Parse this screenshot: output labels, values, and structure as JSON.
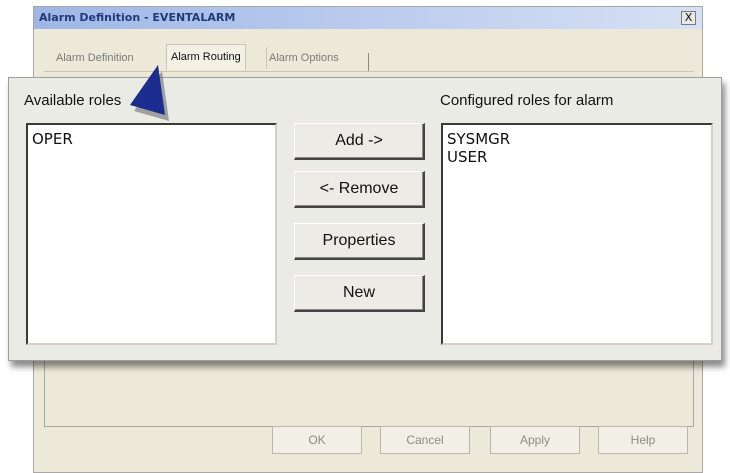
{
  "window": {
    "title": "Alarm Definition - EVENTALARM",
    "close_label": "X"
  },
  "tabs": [
    {
      "label": "Alarm Definition",
      "active": false
    },
    {
      "label": "Alarm Routing",
      "active": true
    },
    {
      "label": "Alarm Options",
      "active": false
    }
  ],
  "routing": {
    "available_label": "Available roles",
    "configured_label": "Configured roles for alarm",
    "available_roles": [
      "OPER"
    ],
    "configured_roles": [
      "SYSMGR",
      "USER"
    ],
    "buttons": {
      "add": "Add ->",
      "remove": "<- Remove",
      "properties": "Properties",
      "new": "New"
    }
  },
  "footer": {
    "ok": "OK",
    "cancel": "Cancel",
    "apply": "Apply",
    "help": "Help"
  },
  "colors": {
    "pointer": "#1a2d8f",
    "titlebar_text": "#1f3b7a"
  }
}
